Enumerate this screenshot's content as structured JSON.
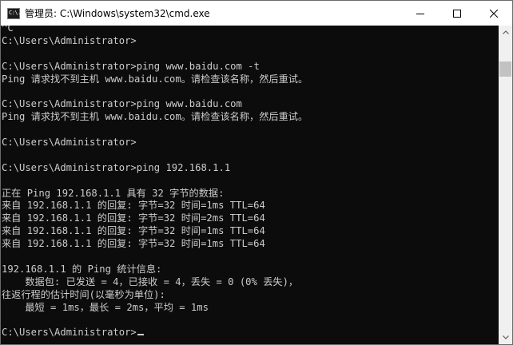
{
  "window": {
    "title": "管理员: C:\\Windows\\system32\\cmd.exe",
    "icon": "cmd-icon",
    "icon_label": "C:\\."
  },
  "controls": {
    "minimize": "minimize-icon",
    "maximize": "maximize-icon",
    "close": "close-icon"
  },
  "console": {
    "lines": [
      "^C",
      "C:\\Users\\Administrator>",
      "",
      "C:\\Users\\Administrator>ping www.baidu.com -t",
      "Ping 请求找不到主机 www.baidu.com。请检查该名称，然后重试。",
      "",
      "C:\\Users\\Administrator>ping www.baidu.com",
      "Ping 请求找不到主机 www.baidu.com。请检查该名称，然后重试。",
      "",
      "C:\\Users\\Administrator>",
      "",
      "C:\\Users\\Administrator>ping 192.168.1.1",
      "",
      "正在 Ping 192.168.1.1 具有 32 字节的数据:",
      "来自 192.168.1.1 的回复: 字节=32 时间=1ms TTL=64",
      "来自 192.168.1.1 的回复: 字节=32 时间=2ms TTL=64",
      "来自 192.168.1.1 的回复: 字节=32 时间=1ms TTL=64",
      "来自 192.168.1.1 的回复: 字节=32 时间=1ms TTL=64",
      "",
      "192.168.1.1 的 Ping 统计信息:",
      "    数据包: 已发送 = 4，已接收 = 4，丢失 = 0 (0% 丢失)，",
      "往返行程的估计时间(以毫秒为单位):",
      "    最短 = 1ms，最长 = 2ms，平均 = 1ms",
      "",
      "C:\\Users\\Administrator>"
    ]
  },
  "scrollbar": {
    "up": "scroll-up-arrow-icon",
    "down": "scroll-down-arrow-icon"
  },
  "colors": {
    "console_bg": "#0c0c0c",
    "console_text": "#cccccc",
    "titlebar_bg": "#ffffff"
  }
}
